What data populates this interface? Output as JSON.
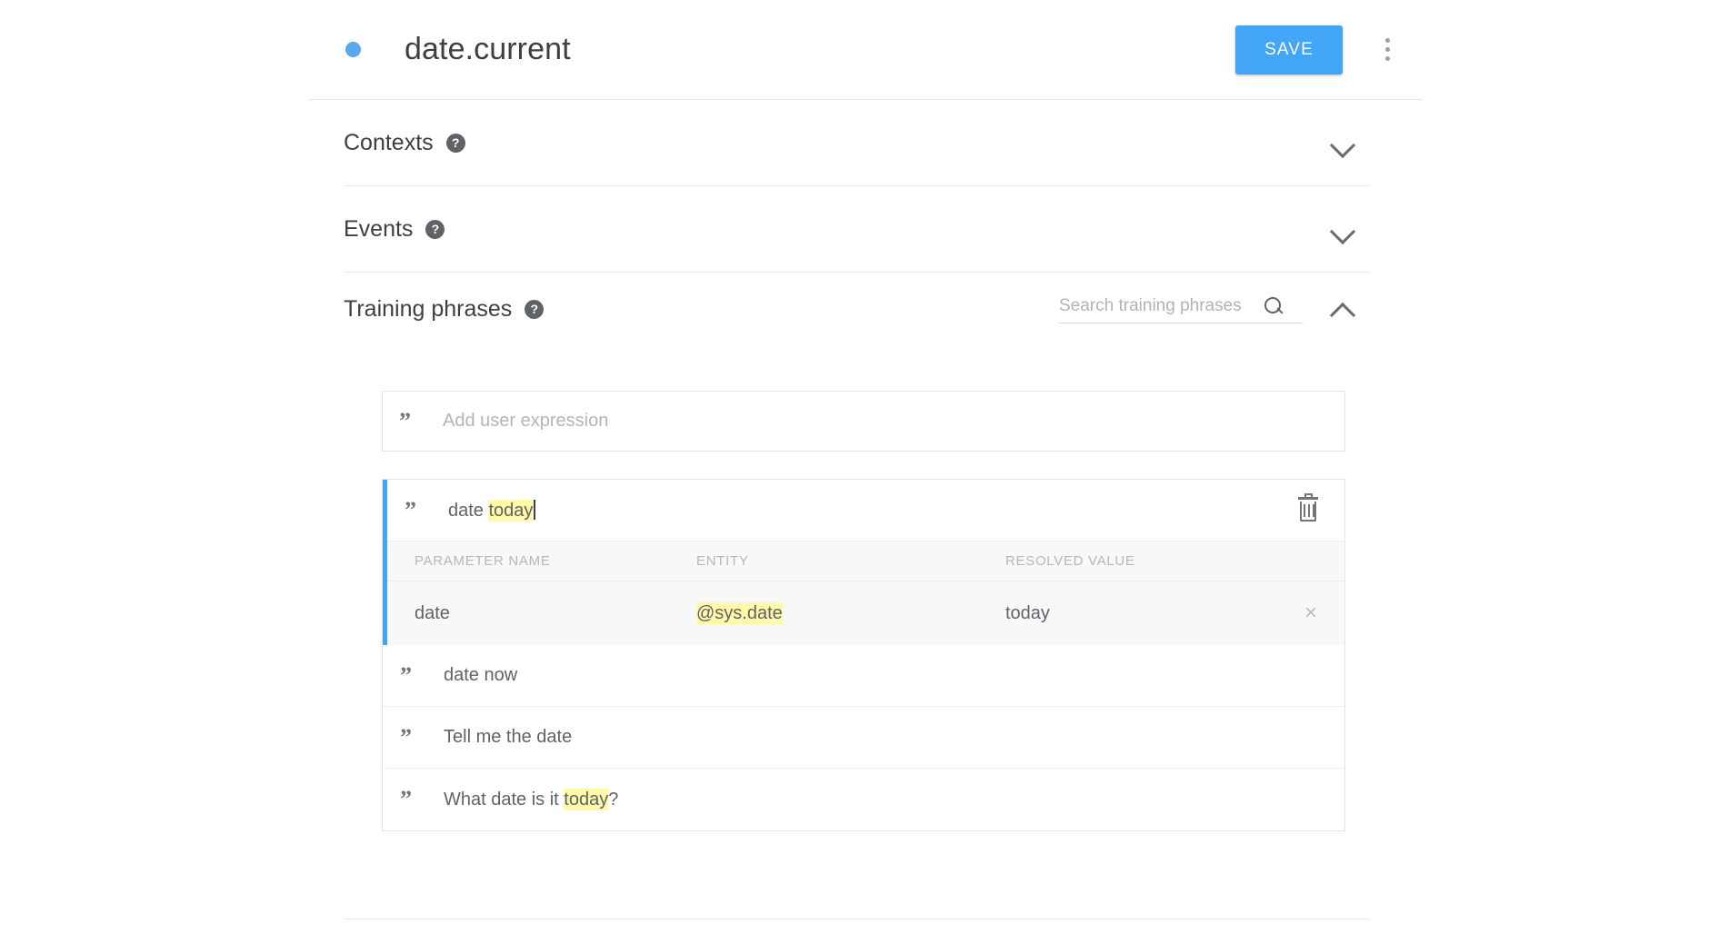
{
  "header": {
    "status_dot_color": "#5aa9ec",
    "title": "date.current",
    "save_label": "SAVE",
    "overflow_menu_name": "more options"
  },
  "sections": [
    {
      "title": "Contexts",
      "help": "?",
      "state": "collapsed"
    },
    {
      "title": "Events",
      "help": "?",
      "state": "collapsed"
    },
    {
      "title": "Training phrases",
      "help": "?",
      "state": "expanded"
    }
  ],
  "training_phrases": {
    "title": "Training phrases",
    "help": "?",
    "search": {
      "placeholder": "Search training phrases",
      "value": ""
    },
    "add_expression": {
      "quote": "”",
      "placeholder": "Add user expression"
    },
    "active_phrase": {
      "quote": "”",
      "prefix": "date ",
      "highlight": "today",
      "suffix": "",
      "has_caret": true
    },
    "parameter_table": {
      "columns": [
        "PARAMETER NAME",
        "ENTITY",
        "RESOLVED VALUE"
      ],
      "rows": [
        {
          "parameter_name": "date",
          "entity": "@sys.date",
          "entity_highlighted": true,
          "resolved_value": "today",
          "remove_label": "×"
        }
      ]
    },
    "phrases": [
      {
        "quote": "”",
        "prefix": "date now",
        "highlight": "",
        "suffix": ""
      },
      {
        "quote": "”",
        "prefix": "Tell me the date",
        "highlight": "",
        "suffix": ""
      },
      {
        "quote": "”",
        "prefix": "What date is it ",
        "highlight": "today",
        "suffix": "?"
      }
    ]
  },
  "colors": {
    "accent_blue": "#42a5f5",
    "highlight_yellow": "#fff9a8",
    "text_primary": "#3c4043",
    "text_secondary": "#5f6368"
  }
}
